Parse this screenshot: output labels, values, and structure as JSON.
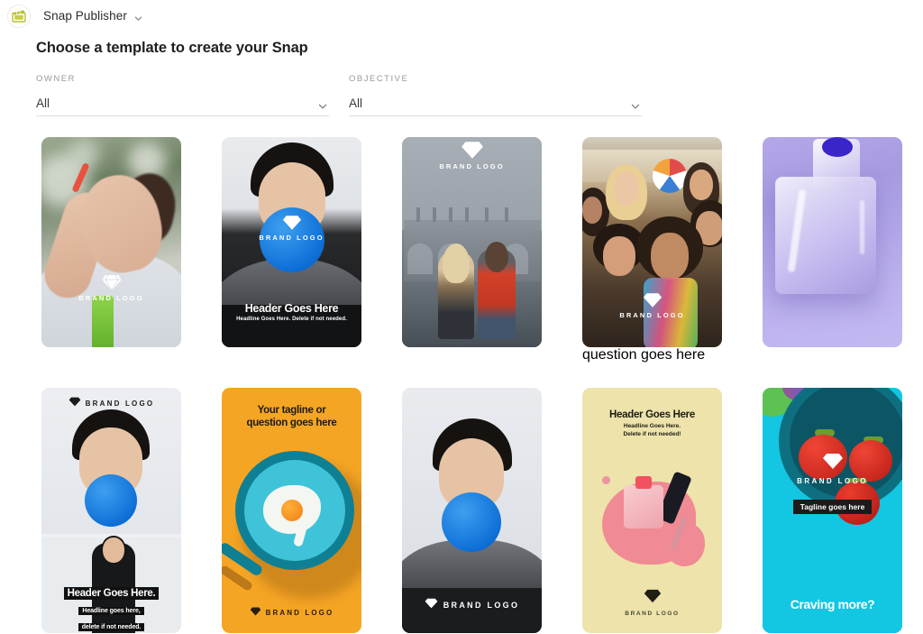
{
  "app": {
    "logo_icon": "clapperboard-icon",
    "name": "Snap Publisher",
    "caret_icon": "chevron-down-icon",
    "accent_color": "#c8cf3f"
  },
  "page": {
    "title": "Choose a template to create your Snap"
  },
  "filters": [
    {
      "label": "OWNER",
      "value": "All",
      "caret_icon": "chevron-down-icon"
    },
    {
      "label": "OBJECTIVE",
      "value": "All",
      "caret_icon": "chevron-down-icon"
    }
  ],
  "templates": [
    {
      "id": "template-bubbles",
      "alt": "Woman blowing bubbles outdoors",
      "brand_logo": "BRAND LOGO",
      "diamond_icon": "diamond-icon"
    },
    {
      "id": "template-blue-gum-dark",
      "alt": "Man blowing blue bubble gum on dark background",
      "brand_logo": "BRAND LOGO",
      "header": "Header Goes Here",
      "subheader": "Headline Goes Here. Delete if not needed.",
      "diamond_icon": "diamond-icon"
    },
    {
      "id": "template-london",
      "alt": "Two women in front of London parliament",
      "brand_logo": "BRAND LOGO",
      "diamond_icon": "diamond-icon"
    },
    {
      "id": "template-beach-group",
      "alt": "Group beach selfie with beach ball",
      "top_text": "question goes here",
      "brand_logo": "BRAND LOGO",
      "diamond_icon": "diamond-icon"
    },
    {
      "id": "template-purple-bottle",
      "alt": "Close up of purple glass bottle"
    },
    {
      "id": "template-split-balloon",
      "alt": "Man with blue balloon split layout",
      "brand_logo": "BRAND LOGO",
      "header": "Header Goes Here.",
      "subheader_line1": "Headline goes here,",
      "subheader_line2": "delete if not needed.",
      "diamond_icon": "diamond-icon"
    },
    {
      "id": "template-egg-pan",
      "alt": "Fried egg in teal pan on orange background",
      "tagline_line1": "Your tagline or",
      "tagline_line2": "question goes here",
      "brand_logo": "BRAND LOGO",
      "diamond_icon": "diamond-icon"
    },
    {
      "id": "template-blue-balloon-light",
      "alt": "Man with blue balloon on light background",
      "brand_logo": "BRAND LOGO",
      "diamond_icon": "diamond-icon"
    },
    {
      "id": "template-nail-polish",
      "alt": "Spilled pink nail polish on yellow background",
      "header": "Header Goes Here",
      "subheader_line1": "Headline Goes Here.",
      "subheader_line2": "Delete if not needed!",
      "brand_logo": "BRAND LOGO",
      "diamond_icon": "diamond-icon"
    },
    {
      "id": "template-tomatoes",
      "alt": "Tomatoes in a teal bowl",
      "brand_logo": "BRAND LOGO",
      "tagline": "Tagline goes here",
      "footer": "Craving more?",
      "diamond_icon": "diamond-icon"
    }
  ]
}
